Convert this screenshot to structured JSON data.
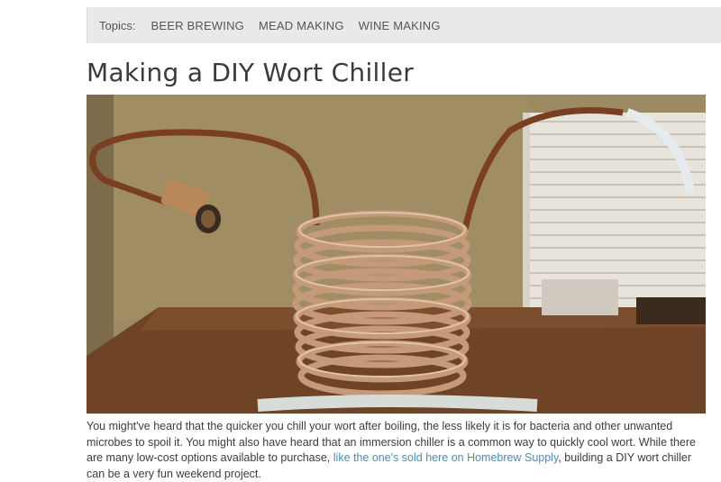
{
  "topics": {
    "label": "Topics:",
    "links": [
      "BEER BREWING",
      "MEAD MAKING",
      "WINE MAKING"
    ]
  },
  "article": {
    "title": "Making a DIY Wort Chiller",
    "body_before_link": "You might've heard that the quicker you chill your wort after boiling, the less likely it is for bacteria and other unwanted microbes to spoil it. You might also have heard that an immersion chiller is a common way to quickly cool wort. While there are many low-cost options available to purchase, ",
    "link_text": "like the one's sold here on Homebrew Supply",
    "body_after_link": ", building a DIY wort chiller can be a very fun weekend project."
  }
}
